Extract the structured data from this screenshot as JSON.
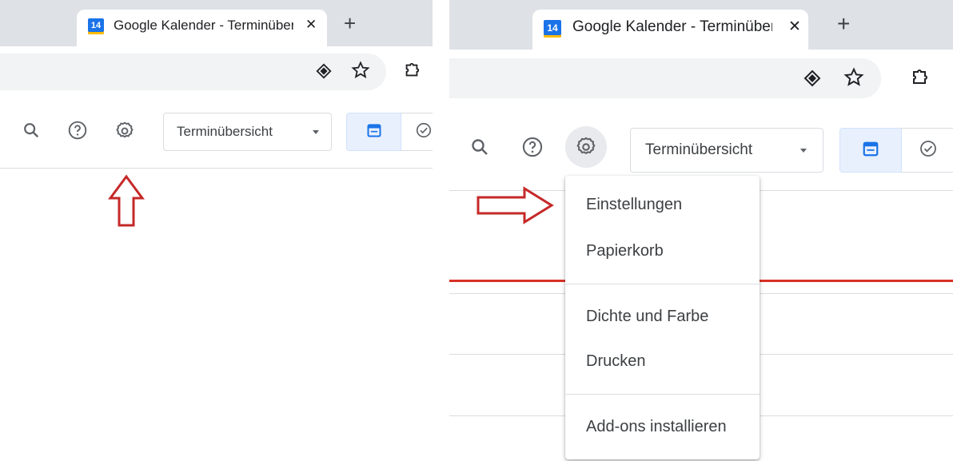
{
  "browser": {
    "tab_title": "Google Kalender - Terminübers",
    "tab_favicon_day": "14",
    "close_glyph": "✕",
    "new_tab_glyph": "+"
  },
  "calendar": {
    "view_selector": "Terminübersicht"
  },
  "settings_menu": {
    "items": [
      {
        "label": "Einstellungen"
      },
      {
        "label": "Papierkorb"
      },
      {
        "label": "Dichte und Farbe"
      },
      {
        "label": "Drucken"
      },
      {
        "label": "Add-ons installieren"
      }
    ]
  },
  "colors": {
    "annotation_arrow": "#c62828",
    "now_line": "#d93025",
    "accent": "#1a73e8",
    "toggle_selected_bg": "#e8f0fe"
  },
  "icons": [
    "search-icon",
    "help-icon",
    "settings-icon",
    "calendar-icon",
    "tasks-icon",
    "star-icon",
    "extensions-icon",
    "site-info-icon"
  ]
}
